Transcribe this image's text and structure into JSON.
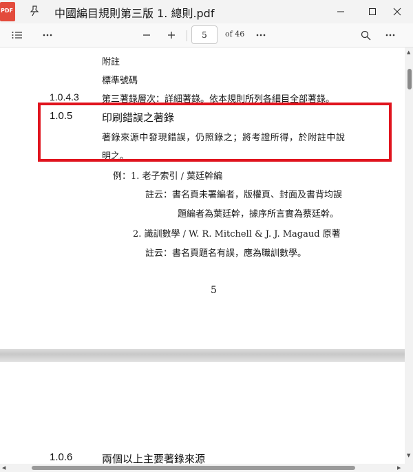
{
  "window": {
    "title": "中國編目規則第三版 1. 總則.pdf",
    "app_icon_label": "PDF",
    "controls": [
      "minimize",
      "maximize",
      "close"
    ]
  },
  "toolbar": {
    "current_page": "5",
    "page_total": "of 46"
  },
  "document": {
    "page1_lines": [
      {
        "label": "",
        "text": "附註"
      },
      {
        "label": "",
        "text": "標準號碼"
      },
      {
        "label": "1.0.4.3",
        "text": "第三著錄層次：詳細著錄。依本規則所列各細目全部著錄。"
      }
    ],
    "section": {
      "number": "1.0.5",
      "heading": "印刷錯誤之著錄",
      "body_line1": "著錄來源中發現錯誤，仍照錄之；將考證所得，於附註中說",
      "body_line2": "明之。"
    },
    "examples": {
      "ex1": "例：1. 老子索引 / 葉廷幹編",
      "ex1_note1": "註云：書名頁未署編者，版權頁、封面及書背均誤",
      "ex1_note2": "題編者為葉廷幹，據序所言實為蔡廷幹。",
      "ex2": "2. 識訓數學 / W. R. Mitchell & J. J. Magaud 原著",
      "ex2_note": "註云：書名頁題名有誤，應為職訓數學。"
    },
    "page_number": "5",
    "page2_section": {
      "number": "1.0.6",
      "heading": "兩個以上主要著錄來源"
    }
  },
  "colors": {
    "highlight_border": "#e0141e",
    "titlebar_bg": "#f3f3f3",
    "pdf_icon": "#e34b3c"
  }
}
